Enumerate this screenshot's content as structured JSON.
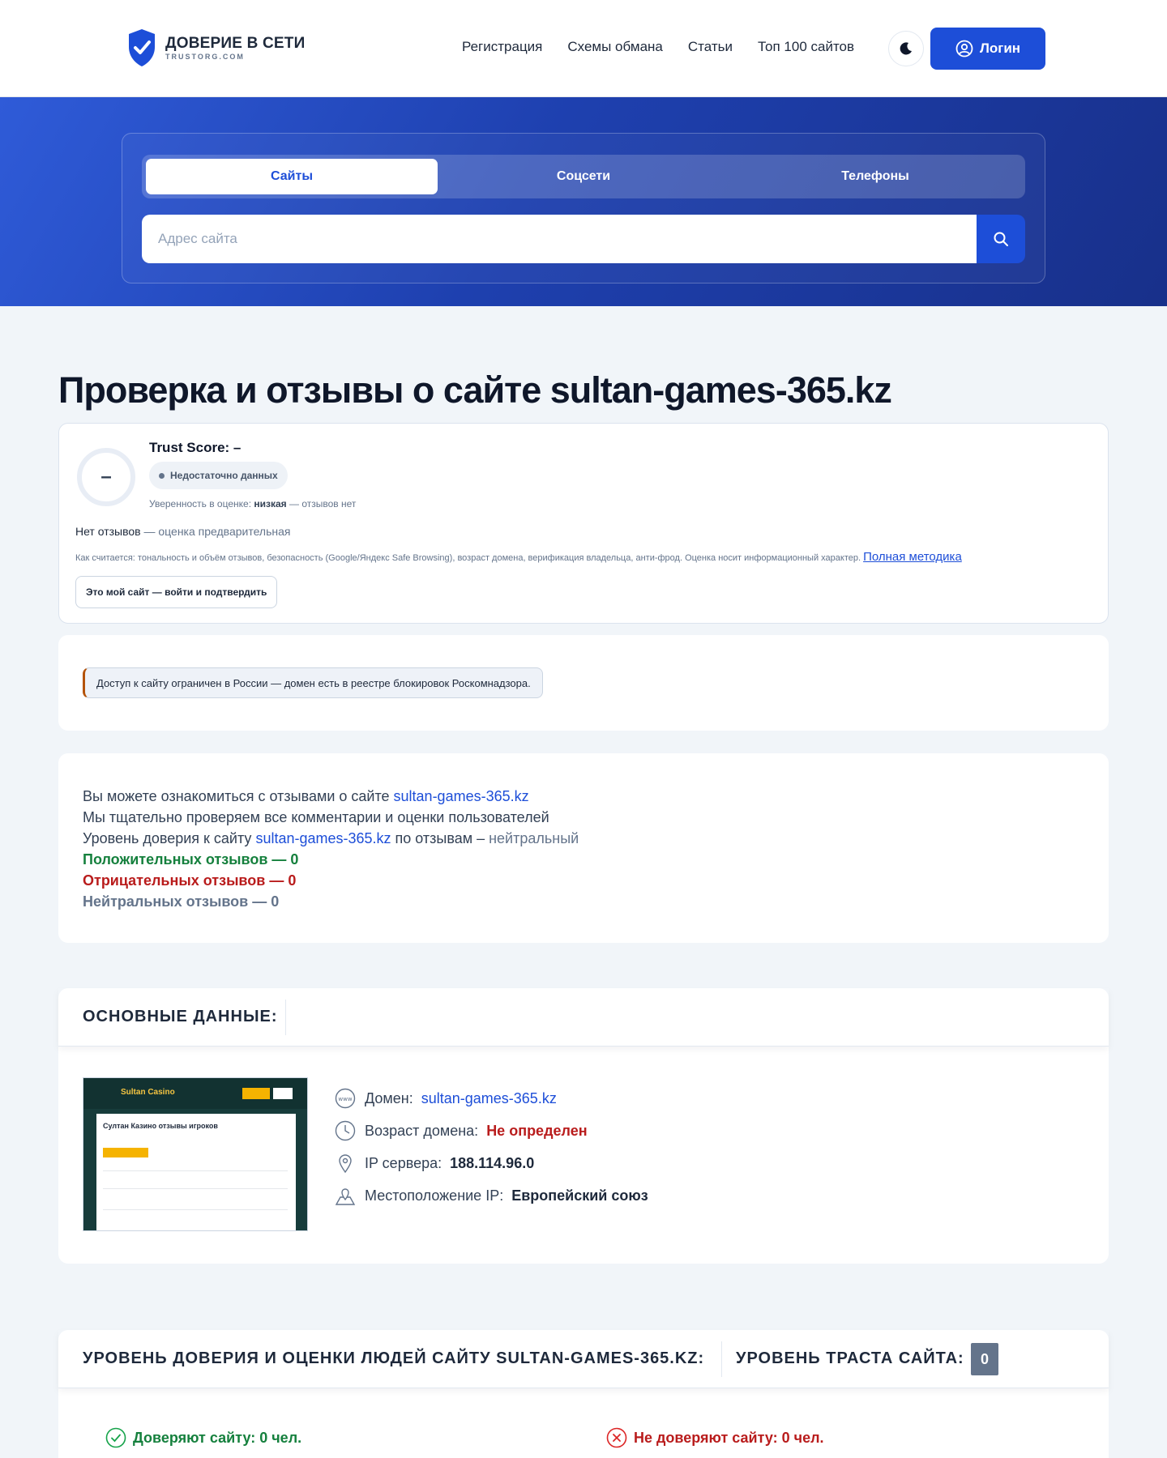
{
  "header": {
    "logo_title": "ДОВЕРИЕ В СЕТИ",
    "logo_sub": "TRUSTORG.COM",
    "nav": [
      "Регистрация",
      "Схемы обмана",
      "Статьи",
      "Топ 100 сайтов"
    ],
    "login_label": "Логин",
    "brand_color": "#1d4ed8"
  },
  "search": {
    "tabs": [
      "Сайты",
      "Соцсети",
      "Телефоны"
    ],
    "active_tab": "Сайты",
    "placeholder": "Адрес сайта",
    "value": ""
  },
  "page_title": "Проверка и отзывы о сайте sultan-games-365.kz",
  "trust": {
    "score_symbol": "–",
    "title": "Trust Score: –",
    "badge": "Недостаточно данных",
    "confidence_prefix": "Уверенность в оценке: ",
    "confidence_value": "низкая",
    "confidence_suffix": " — отзывов нет",
    "no_reviews": "Нет отзывов",
    "no_reviews_suffix": " — оценка предварительная",
    "method_text": "Как считается: тональность и объём отзывов, безопасность (Google/Яндекс Safe Browsing), возраст домена, верификация владельца, анти-фрод. Оценка носит информационный характер. ",
    "method_link": "Полная методика",
    "own_site_button": "Это мой сайт — войти и подтвердить"
  },
  "alert": {
    "text": "Доступ к сайту ограничен в России — домен есть в реестре блокировок Роскомнадзора."
  },
  "summary": {
    "line1_prefix": "Вы можете ознакомиться с отзывами о сайте ",
    "domain": "sultan-games-365.kz",
    "line2": "Мы тщательно проверяем все комментарии и оценки пользователей",
    "line3_prefix": "Уровень доверия к сайту ",
    "line3_mid": " по отзывам – ",
    "line3_level": "нейтральный",
    "positive": "Положительных отзывов — 0",
    "negative": "Отрицательных отзывов — 0",
    "neutral": "Нейтральных отзывов — 0"
  },
  "basic": {
    "heading": "ОСНОВНЫЕ ДАННЫЕ:",
    "thumb_brand": "Sultan Casino",
    "thumb_heading": "Султан Казино отзывы игроков",
    "domain_label": "Домен:",
    "domain_value": "sultan-games-365.kz",
    "age_label": "Возраст домена:",
    "age_value": "Не определен",
    "ip_label": "IP сервера:",
    "ip_value": "188.114.96.0",
    "location_label": "Местоположение IP:",
    "location_value": "Европейский союз"
  },
  "level": {
    "heading": "УРОВЕНЬ ДОВЕРИЯ И ОЦЕНКИ ЛЮДЕЙ САЙТУ SULTAN-GAMES-365.KZ:",
    "trust_label": "УРОВЕНЬ ТРАСТА САЙТА:",
    "trust_value": "0",
    "trust_yes": "Доверяют сайту: 0 чел.",
    "trust_no": "Не доверяют сайту: 0 чел."
  }
}
